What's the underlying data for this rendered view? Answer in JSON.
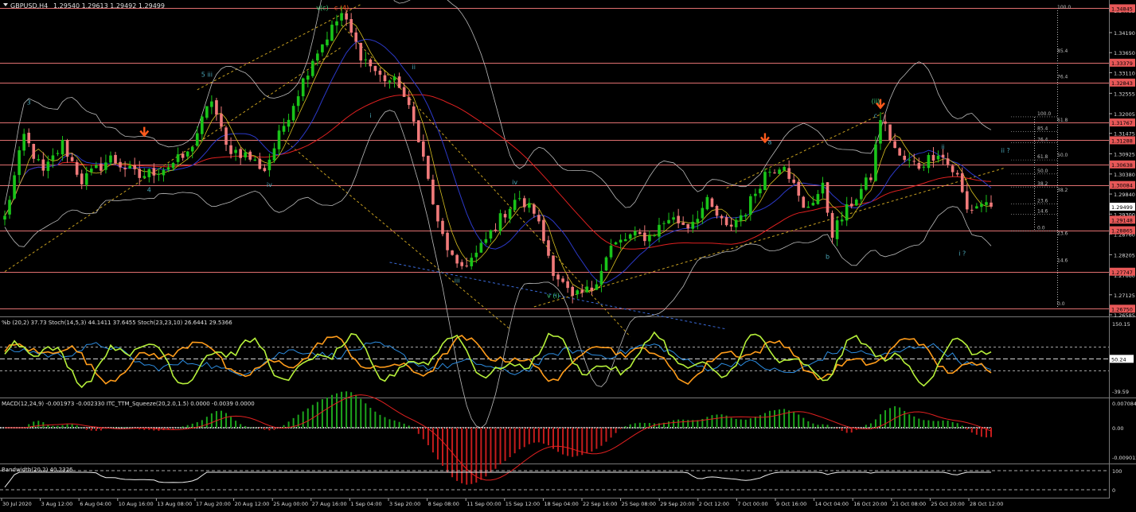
{
  "header": {
    "symbol": "GBPUSD,H4",
    "ohlc": "1.29540 1.29613 1.29492 1.29499"
  },
  "panels": {
    "stoch_label": "%b (20,2) 37.73 Stoch(14,5,3) 44.1411 37.6455 Stoch(23,23,10) 26.6441 29.5366",
    "macd_label": "MACD(12,24,9) -0.001973 -0.002330 ITC_TTM_Squeeze(20,2.0,1.5) 0.0000 -0.0039 0.0000",
    "bw_label": "Bandwidth(20,2) 40.2326"
  },
  "colors": {
    "bull": "#19c419",
    "bear": "#f07a7a",
    "hline": "#e07070",
    "price_tag": "#e85858",
    "wave_cyan": "#4aa6b8",
    "wave_green": "#3fd07a",
    "ma_red": "#e02020",
    "ma_blue": "#2c39c8",
    "ma_yellow": "#d8c020",
    "fib": "#bbbbbb",
    "arrow": "#ff5a1c",
    "stoch_green": "#b6f03a",
    "stoch_orange": "#ff9c1a",
    "stoch_blue": "#2c8ce0",
    "macd_bar_up": "#1ca41c",
    "macd_bar_dn": "#c41c1c"
  },
  "price_axis": {
    "min": 1.26585,
    "max": 1.3479,
    "labels": [
      "1.34795",
      "1.34190",
      "1.33650",
      "1.33110",
      "1.32555",
      "1.32005",
      "1.31475",
      "1.30925",
      "1.30380",
      "1.29840",
      "1.29300",
      "1.28760",
      "1.28205",
      "1.27660",
      "1.27125",
      "1.26585"
    ],
    "levels": [
      {
        "price": 1.34845,
        "label": "1.34845"
      },
      {
        "price": 1.33379,
        "label": "1.33379"
      },
      {
        "price": 1.32843,
        "label": "1.32843"
      },
      {
        "price": 1.31767,
        "label": "1.31767"
      },
      {
        "price": 1.31288,
        "label": "1.31288"
      },
      {
        "price": 1.30638,
        "label": "1.30638"
      },
      {
        "price": 1.30084,
        "label": "1.30084"
      },
      {
        "price": 1.28865,
        "label": "1.28865"
      },
      {
        "price": 1.27747,
        "label": "1.27747"
      },
      {
        "price": 1.2675,
        "label": "1.26750"
      }
    ],
    "current": {
      "price": 1.29499,
      "label": "1.29499"
    },
    "extra": {
      "price": 1.29148,
      "label": "1.29148"
    }
  },
  "x_labels": [
    "30 Jul 2020",
    "3 Aug 12:00",
    "6 Aug 04:00",
    "10 Aug 16:00",
    "13 Aug 08:00",
    "17 Aug 20:00",
    "20 Aug 12:00",
    "25 Aug 00:00",
    "27 Aug 16:00",
    "1 Sep 04:00",
    "3 Sep 20:00",
    "8 Sep 08:00",
    "11 Sep 00:00",
    "15 Sep 12:00",
    "18 Sep 04:00",
    "22 Sep 16:00",
    "25 Sep 08:00",
    "29 Sep 20:00",
    "2 Oct 12:00",
    "7 Oct 00:00",
    "9 Oct 16:00",
    "14 Oct 04:00",
    "16 Oct 20:00",
    "21 Oct 08:00",
    "25 Oct 20:00",
    "28 Oct 12:00"
  ],
  "fib_big": [
    {
      "pct": "100.0",
      "price": 1.3479
    },
    {
      "pct": "85.4",
      "price": 1.3361
    },
    {
      "pct": "76.4",
      "price": 1.3292
    },
    {
      "pct": "61.8",
      "price": 1.3175
    },
    {
      "pct": "50.0",
      "price": 1.3081
    },
    {
      "pct": "38.2",
      "price": 1.2986
    },
    {
      "pct": "23.6",
      "price": 1.2869
    },
    {
      "pct": "14.6",
      "price": 1.2797
    },
    {
      "pct": "0.0",
      "price": 1.268
    }
  ],
  "fib_small": [
    {
      "pct": "100.0",
      "price": 1.3192
    },
    {
      "pct": "85.4",
      "price": 1.3152
    },
    {
      "pct": "76.4",
      "price": 1.3122
    },
    {
      "pct": "61.8",
      "price": 1.3076
    },
    {
      "pct": "50.0",
      "price": 1.3038
    },
    {
      "pct": "38.2",
      "price": 1.3003
    },
    {
      "pct": "23.6",
      "price": 1.2957
    },
    {
      "pct": "14.6",
      "price": 1.2929
    },
    {
      "pct": "0.0",
      "price": 1.2885
    }
  ],
  "wave_labels": [
    {
      "text": "3",
      "price": 1.3225,
      "xi": 5,
      "color": "cyan"
    },
    {
      "text": "4",
      "price": 1.299,
      "xi": 30,
      "color": "cyan"
    },
    {
      "text": "5 iii",
      "price": 1.33,
      "xi": 42,
      "color": "cyan"
    },
    {
      "text": "iv",
      "price": 1.3003,
      "xi": 55,
      "color": "cyan"
    },
    {
      "text": "v(c)",
      "price": 1.348,
      "xi": 66,
      "color": "green"
    },
    {
      "text": "c (4)",
      "price": 1.348,
      "xi": 70,
      "color": "red"
    },
    {
      "text": "i",
      "price": 1.319,
      "xi": 76,
      "color": "cyan"
    },
    {
      "text": "ii",
      "price": 1.332,
      "xi": 85,
      "color": "cyan"
    },
    {
      "text": "iii",
      "price": 1.2745,
      "xi": 94,
      "color": "cyan"
    },
    {
      "text": "iv",
      "price": 1.301,
      "xi": 106,
      "color": "cyan"
    },
    {
      "text": "v (i)",
      "price": 1.2705,
      "xi": 114,
      "color": "green"
    },
    {
      "text": "a",
      "price": 1.3118,
      "xi": 159,
      "color": "cyan"
    },
    {
      "text": "b",
      "price": 1.281,
      "xi": 171,
      "color": "cyan"
    },
    {
      "text": "(ii)",
      "price": 1.3228,
      "xi": 181,
      "color": "green"
    },
    {
      "text": "c",
      "price": 1.319,
      "xi": 181,
      "color": "cyan"
    },
    {
      "text": "ii",
      "price": 1.3105,
      "xi": 195,
      "color": "cyan"
    },
    {
      "text": "ii ?",
      "price": 1.3095,
      "xi": 208,
      "color": "cyan"
    },
    {
      "text": "i ?",
      "price": 1.2818,
      "xi": 199,
      "color": "cyan"
    }
  ],
  "chart_data": {
    "type": "candlestick",
    "ylim": [
      1.26585,
      1.3479
    ],
    "waypoints": [
      [
        0,
        1.292
      ],
      [
        4,
        1.314
      ],
      [
        8,
        1.304
      ],
      [
        12,
        1.312
      ],
      [
        16,
        1.302
      ],
      [
        22,
        1.308
      ],
      [
        28,
        1.303
      ],
      [
        34,
        1.306
      ],
      [
        38,
        1.309
      ],
      [
        43,
        1.324
      ],
      [
        46,
        1.311
      ],
      [
        50,
        1.309
      ],
      [
        54,
        1.305
      ],
      [
        58,
        1.317
      ],
      [
        64,
        1.335
      ],
      [
        70,
        1.347
      ],
      [
        74,
        1.336
      ],
      [
        78,
        1.33
      ],
      [
        82,
        1.328
      ],
      [
        86,
        1.314
      ],
      [
        90,
        1.29
      ],
      [
        94,
        1.278
      ],
      [
        98,
        1.282
      ],
      [
        102,
        1.29
      ],
      [
        106,
        1.297
      ],
      [
        110,
        1.294
      ],
      [
        114,
        1.278
      ],
      [
        118,
        1.27
      ],
      [
        122,
        1.273
      ],
      [
        126,
        1.284
      ],
      [
        130,
        1.287
      ],
      [
        134,
        1.287
      ],
      [
        138,
        1.292
      ],
      [
        142,
        1.29
      ],
      [
        146,
        1.296
      ],
      [
        150,
        1.289
      ],
      [
        154,
        1.294
      ],
      [
        158,
        1.304
      ],
      [
        162,
        1.307
      ],
      [
        166,
        1.294
      ],
      [
        170,
        1.3
      ],
      [
        172,
        1.288
      ],
      [
        176,
        1.296
      ],
      [
        180,
        1.303
      ],
      [
        182,
        1.319
      ],
      [
        186,
        1.308
      ],
      [
        190,
        1.306
      ],
      [
        194,
        1.31
      ],
      [
        198,
        1.303
      ],
      [
        200,
        1.294
      ],
      [
        203,
        1.296
      ],
      [
        205,
        1.2958
      ]
    ],
    "stoch_levels": {
      "upper": 80,
      "mid": 50.24,
      "lower": 20
    },
    "stoch_axis": [
      "150.15",
      "50.24",
      "-39.59"
    ],
    "macd_axis": [
      "0.007084",
      "0.00",
      "-0.009012"
    ],
    "bw_axis": [
      "100",
      "0"
    ]
  }
}
